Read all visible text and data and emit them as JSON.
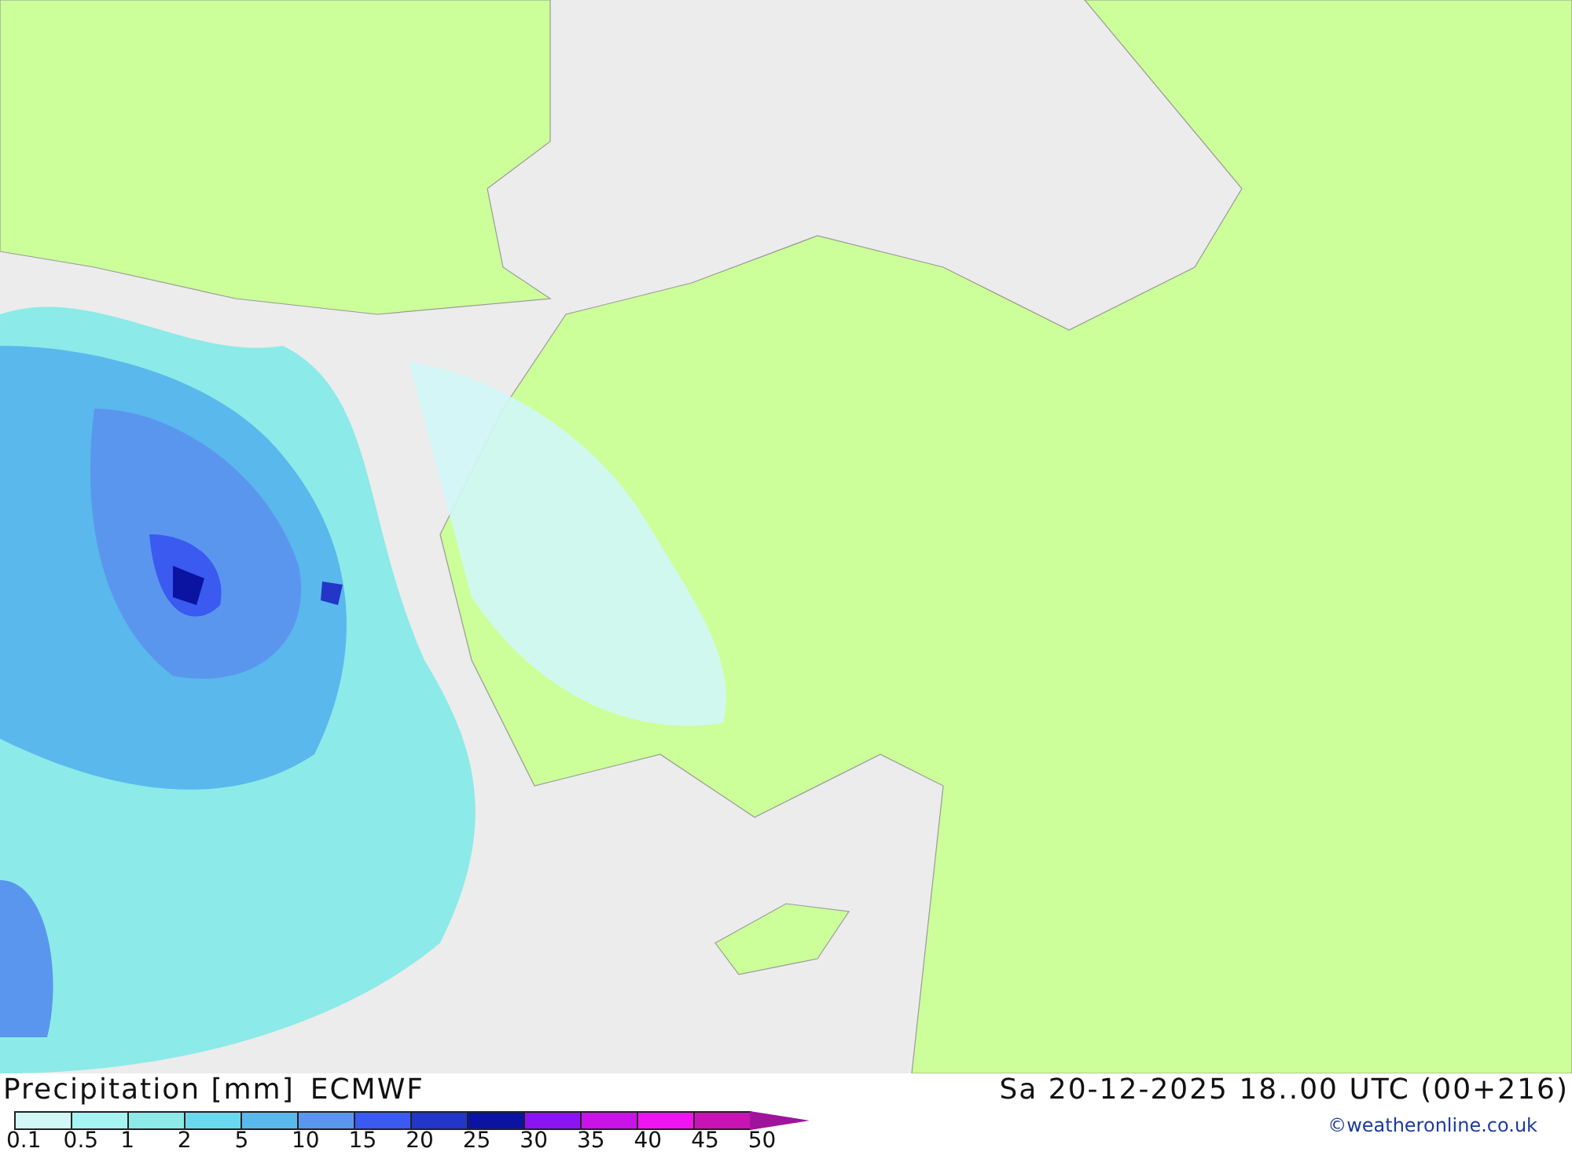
{
  "map": {
    "title": "Precipitation [mm]",
    "model": "ECMWF",
    "valid_time": "Sa 20-12-2025 18..00 UTC (00+216)",
    "credit": "©weatheronline.co.uk"
  },
  "legend": {
    "segments": [
      {
        "color": "#d2f7f7"
      },
      {
        "color": "#a5f3f3"
      },
      {
        "color": "#8ceae8"
      },
      {
        "color": "#6ad9ee"
      },
      {
        "color": "#5ab8ec"
      },
      {
        "color": "#5a96ee"
      },
      {
        "color": "#3a5af0"
      },
      {
        "color": "#2236c8"
      },
      {
        "color": "#0a14a0"
      },
      {
        "color": "#8c14f0"
      },
      {
        "color": "#c814e6"
      },
      {
        "color": "#f014f0"
      },
      {
        "color": "#c814b4"
      }
    ],
    "arrow": {
      "color": "#a0149c"
    },
    "labels": [
      "0.1",
      "0.5",
      "1",
      "2",
      "5",
      "10",
      "15",
      "20",
      "25",
      "30",
      "35",
      "40",
      "45",
      "50"
    ]
  }
}
